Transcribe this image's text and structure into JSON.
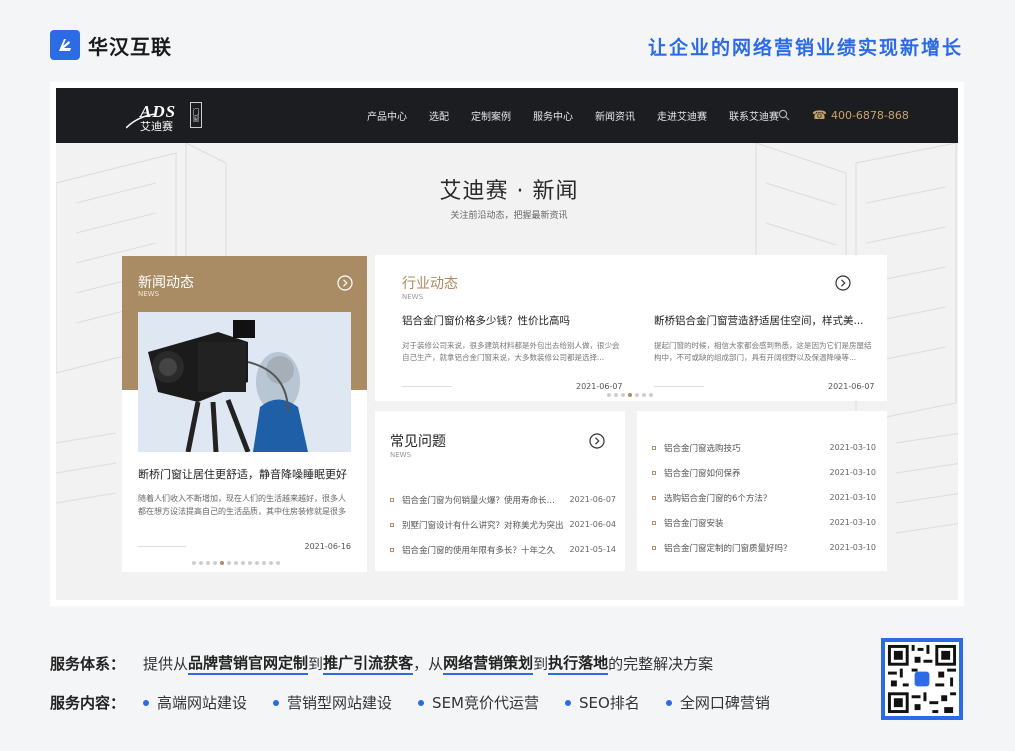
{
  "brand": {
    "name": "华汉互联",
    "slogan": "让企业的网络营销业绩实现新增长",
    "accent_color": "#2d6be4"
  },
  "site": {
    "logo": {
      "mark": "ADS",
      "name": "艾迪赛",
      "tag": "门窗"
    },
    "nav": [
      {
        "label": "产品中心"
      },
      {
        "label": "选配"
      },
      {
        "label": "定制案例"
      },
      {
        "label": "服务中心"
      },
      {
        "label": "新闻资讯"
      },
      {
        "label": "走进艾迪赛"
      },
      {
        "label": "联系艾迪赛"
      }
    ],
    "search_icon": "search-icon",
    "phone": "400-6878-868",
    "section_title": "艾迪赛 · 新闻",
    "section_subtitle": "关注前沿动态，把握最新资讯",
    "gold_color": "#a98c64",
    "news": {
      "title": "新闻动态",
      "en": "NEWS",
      "headline": "断桥门窗让居住更舒适，静音降噪睡眠更好",
      "excerpt": "随着人们收入不断增加，现在人们的生活越来越好，很多人都在想方设法提高自己的生活品质，其中住房装修就是很多人...",
      "date": "2021-06-16",
      "dots_total": 13,
      "dots_active": 5
    },
    "industry": {
      "title": "行业动态",
      "en": "NEWS",
      "items": [
        {
          "title": "铝合金门窗价格多少钱？性价比高吗",
          "text": "对于装修公司来说，很多建筑材料都是外包出去给别人做，很少会自己生产，就拿铝合金门窗来说，大多数装修公司都是选择...",
          "date": "2021-06-07"
        },
        {
          "title": "断桥铝合金门窗营造舒适居住空间，样式美...",
          "text": "提起门窗的时候，相信大家都会感到熟悉，这是因为它们是房屋结构中，不可或缺的组成部门，具有开阔视野以及保温降噪等...",
          "date": "2021-06-07"
        }
      ],
      "dots_total": 7,
      "dots_active": 4
    },
    "faq": {
      "title": "常见问题",
      "en": "NEWS",
      "items": [
        {
          "text": "铝合金门窗为何销量火爆？使用寿命长就是王...",
          "date": "2021-06-07"
        },
        {
          "text": "别墅门窗设计有什么讲究？对称美尤为突出",
          "date": "2021-06-04"
        },
        {
          "text": "铝合金门窗的使用年限有多长？十年之久",
          "date": "2021-05-14"
        }
      ]
    },
    "list2": {
      "items": [
        {
          "text": "铝合金门窗选购技巧",
          "date": "2021-03-10"
        },
        {
          "text": "铝合金门窗如何保养",
          "date": "2021-03-10"
        },
        {
          "text": "选购铝合金门窗的6个方法？",
          "date": "2021-03-10"
        },
        {
          "text": "铝合金门窗安装",
          "date": "2021-03-10"
        },
        {
          "text": "铝合金门窗定制的门窗质量好吗？",
          "date": "2021-03-10"
        }
      ]
    }
  },
  "service": {
    "system_label": "服务体系：",
    "system_parts": {
      "p1": "提供从",
      "h1": "品牌营销官网定制",
      "p2": "到",
      "h2": "推广引流获客",
      "p3": "，从",
      "h3": "网络营销策划",
      "p4": "到",
      "h4": "执行落地",
      "p5": "的完整解决方案"
    },
    "content_label": "服务内容：",
    "content_items": [
      {
        "label": "高端网站建设"
      },
      {
        "label": "营销型网站建设"
      },
      {
        "label": "SEM竞价代运营"
      },
      {
        "label": "SEO排名"
      },
      {
        "label": "全网口碑营销"
      }
    ]
  }
}
